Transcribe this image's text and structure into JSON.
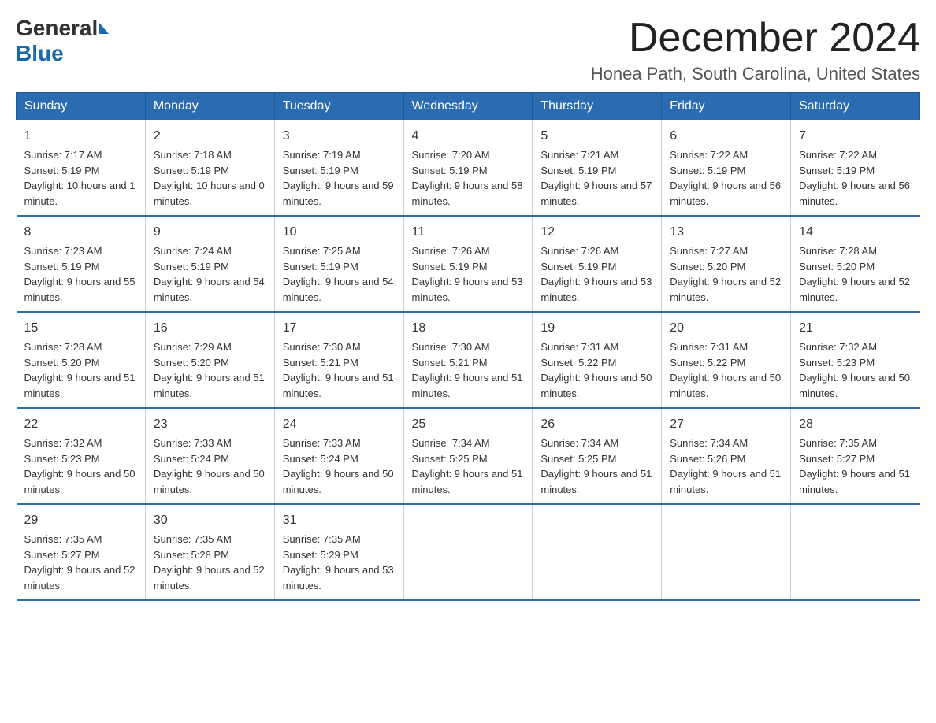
{
  "logo": {
    "general": "General",
    "blue": "Blue"
  },
  "title": "December 2024",
  "location": "Honea Path, South Carolina, United States",
  "days_of_week": [
    "Sunday",
    "Monday",
    "Tuesday",
    "Wednesday",
    "Thursday",
    "Friday",
    "Saturday"
  ],
  "weeks": [
    [
      {
        "day": "1",
        "sunrise": "7:17 AM",
        "sunset": "5:19 PM",
        "daylight": "10 hours and 1 minute."
      },
      {
        "day": "2",
        "sunrise": "7:18 AM",
        "sunset": "5:19 PM",
        "daylight": "10 hours and 0 minutes."
      },
      {
        "day": "3",
        "sunrise": "7:19 AM",
        "sunset": "5:19 PM",
        "daylight": "9 hours and 59 minutes."
      },
      {
        "day": "4",
        "sunrise": "7:20 AM",
        "sunset": "5:19 PM",
        "daylight": "9 hours and 58 minutes."
      },
      {
        "day": "5",
        "sunrise": "7:21 AM",
        "sunset": "5:19 PM",
        "daylight": "9 hours and 57 minutes."
      },
      {
        "day": "6",
        "sunrise": "7:22 AM",
        "sunset": "5:19 PM",
        "daylight": "9 hours and 56 minutes."
      },
      {
        "day": "7",
        "sunrise": "7:22 AM",
        "sunset": "5:19 PM",
        "daylight": "9 hours and 56 minutes."
      }
    ],
    [
      {
        "day": "8",
        "sunrise": "7:23 AM",
        "sunset": "5:19 PM",
        "daylight": "9 hours and 55 minutes."
      },
      {
        "day": "9",
        "sunrise": "7:24 AM",
        "sunset": "5:19 PM",
        "daylight": "9 hours and 54 minutes."
      },
      {
        "day": "10",
        "sunrise": "7:25 AM",
        "sunset": "5:19 PM",
        "daylight": "9 hours and 54 minutes."
      },
      {
        "day": "11",
        "sunrise": "7:26 AM",
        "sunset": "5:19 PM",
        "daylight": "9 hours and 53 minutes."
      },
      {
        "day": "12",
        "sunrise": "7:26 AM",
        "sunset": "5:19 PM",
        "daylight": "9 hours and 53 minutes."
      },
      {
        "day": "13",
        "sunrise": "7:27 AM",
        "sunset": "5:20 PM",
        "daylight": "9 hours and 52 minutes."
      },
      {
        "day": "14",
        "sunrise": "7:28 AM",
        "sunset": "5:20 PM",
        "daylight": "9 hours and 52 minutes."
      }
    ],
    [
      {
        "day": "15",
        "sunrise": "7:28 AM",
        "sunset": "5:20 PM",
        "daylight": "9 hours and 51 minutes."
      },
      {
        "day": "16",
        "sunrise": "7:29 AM",
        "sunset": "5:20 PM",
        "daylight": "9 hours and 51 minutes."
      },
      {
        "day": "17",
        "sunrise": "7:30 AM",
        "sunset": "5:21 PM",
        "daylight": "9 hours and 51 minutes."
      },
      {
        "day": "18",
        "sunrise": "7:30 AM",
        "sunset": "5:21 PM",
        "daylight": "9 hours and 51 minutes."
      },
      {
        "day": "19",
        "sunrise": "7:31 AM",
        "sunset": "5:22 PM",
        "daylight": "9 hours and 50 minutes."
      },
      {
        "day": "20",
        "sunrise": "7:31 AM",
        "sunset": "5:22 PM",
        "daylight": "9 hours and 50 minutes."
      },
      {
        "day": "21",
        "sunrise": "7:32 AM",
        "sunset": "5:23 PM",
        "daylight": "9 hours and 50 minutes."
      }
    ],
    [
      {
        "day": "22",
        "sunrise": "7:32 AM",
        "sunset": "5:23 PM",
        "daylight": "9 hours and 50 minutes."
      },
      {
        "day": "23",
        "sunrise": "7:33 AM",
        "sunset": "5:24 PM",
        "daylight": "9 hours and 50 minutes."
      },
      {
        "day": "24",
        "sunrise": "7:33 AM",
        "sunset": "5:24 PM",
        "daylight": "9 hours and 50 minutes."
      },
      {
        "day": "25",
        "sunrise": "7:34 AM",
        "sunset": "5:25 PM",
        "daylight": "9 hours and 51 minutes."
      },
      {
        "day": "26",
        "sunrise": "7:34 AM",
        "sunset": "5:25 PM",
        "daylight": "9 hours and 51 minutes."
      },
      {
        "day": "27",
        "sunrise": "7:34 AM",
        "sunset": "5:26 PM",
        "daylight": "9 hours and 51 minutes."
      },
      {
        "day": "28",
        "sunrise": "7:35 AM",
        "sunset": "5:27 PM",
        "daylight": "9 hours and 51 minutes."
      }
    ],
    [
      {
        "day": "29",
        "sunrise": "7:35 AM",
        "sunset": "5:27 PM",
        "daylight": "9 hours and 52 minutes."
      },
      {
        "day": "30",
        "sunrise": "7:35 AM",
        "sunset": "5:28 PM",
        "daylight": "9 hours and 52 minutes."
      },
      {
        "day": "31",
        "sunrise": "7:35 AM",
        "sunset": "5:29 PM",
        "daylight": "9 hours and 53 minutes."
      },
      null,
      null,
      null,
      null
    ]
  ]
}
